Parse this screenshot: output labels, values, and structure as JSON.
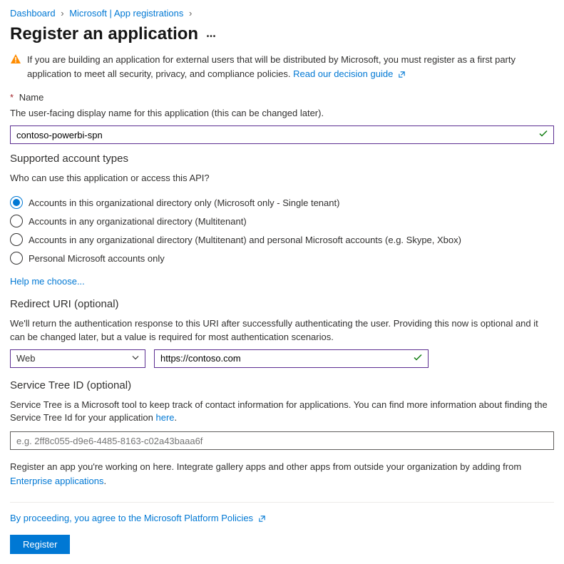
{
  "breadcrumb": {
    "items": [
      "Dashboard",
      "Microsoft | App registrations"
    ]
  },
  "page": {
    "title": "Register an application"
  },
  "alert": {
    "text": "If you are building an application for external users that will be distributed by Microsoft, you must register as a first party application to meet all security, privacy, and compliance policies.",
    "link": "Read our decision guide"
  },
  "name": {
    "label": "Name",
    "hint": "The user-facing display name for this application (this can be changed later).",
    "value": "contoso-powerbi-spn"
  },
  "accountTypes": {
    "title": "Supported account types",
    "question": "Who can use this application or access this API?",
    "options": [
      "Accounts in this organizational directory only (Microsoft only - Single tenant)",
      "Accounts in any organizational directory (Multitenant)",
      "Accounts in any organizational directory (Multitenant) and personal Microsoft accounts (e.g. Skype, Xbox)",
      "Personal Microsoft accounts only"
    ],
    "helpLink": "Help me choose..."
  },
  "redirect": {
    "title": "Redirect URI (optional)",
    "hint": "We'll return the authentication response to this URI after successfully authenticating the user. Providing this now is optional and it can be changed later, but a value is required for most authentication scenarios.",
    "platform": "Web",
    "uri": "https://contoso.com"
  },
  "serviceTree": {
    "title": "Service Tree ID (optional)",
    "hintPrefix": "Service Tree is a Microsoft tool to keep track of contact information for applications. You can find more information about finding the Service Tree Id for your application ",
    "hintLink": "here",
    "placeholder": "e.g. 2ff8c055-d9e6-4485-8163-c02a43baaa6f"
  },
  "footer": {
    "notePrefix": "Register an app you're working on here. Integrate gallery apps and other apps from outside your organization by adding from ",
    "noteLink": "Enterprise applications",
    "policy": "By proceeding, you agree to the Microsoft Platform Policies",
    "registerLabel": "Register"
  }
}
